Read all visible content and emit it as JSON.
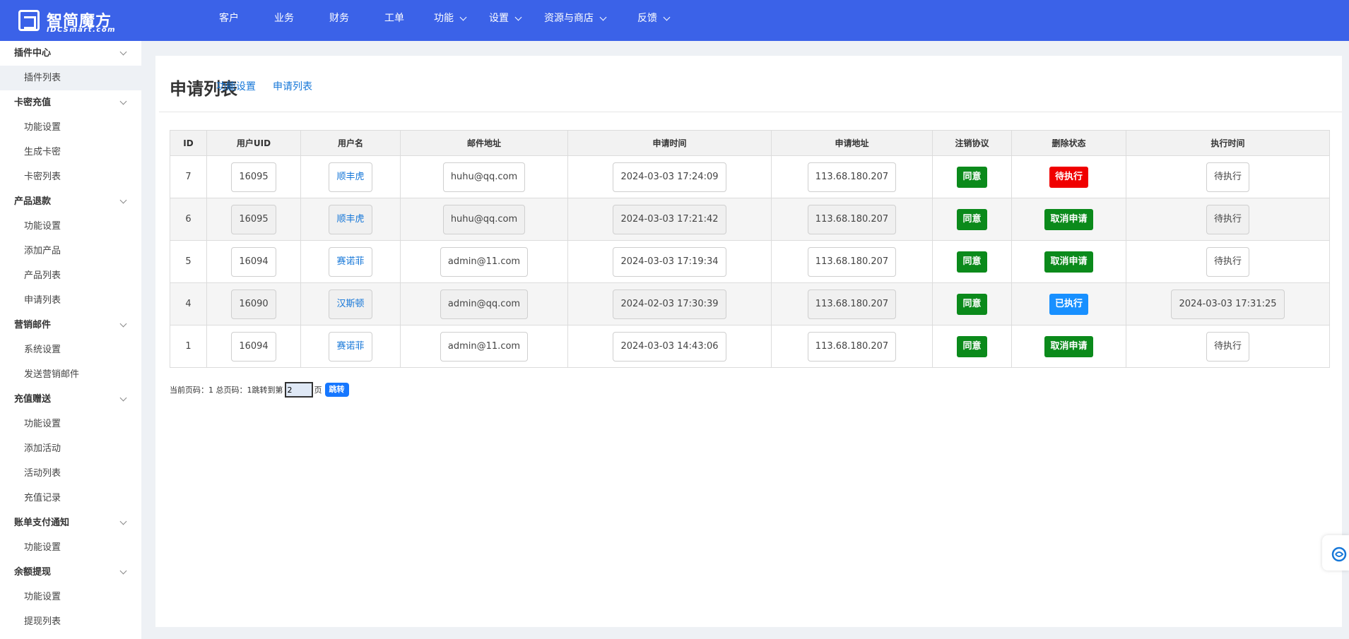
{
  "brand": {
    "name_cn": "智简魔方",
    "name_en": "IDCSmart.com"
  },
  "nav": {
    "items": [
      {
        "label": "客户",
        "has_dropdown": false
      },
      {
        "label": "业务",
        "has_dropdown": false
      },
      {
        "label": "财务",
        "has_dropdown": false
      },
      {
        "label": "工单",
        "has_dropdown": false
      },
      {
        "label": "功能",
        "has_dropdown": true
      },
      {
        "label": "设置",
        "has_dropdown": true
      },
      {
        "label": "资源与商店",
        "has_dropdown": true
      },
      {
        "label": "反馈",
        "has_dropdown": true
      }
    ]
  },
  "sidebar": {
    "groups": [
      {
        "label": "插件中心",
        "items": [
          "插件列表"
        ]
      },
      {
        "label": "卡密充值",
        "items": [
          "功能设置",
          "生成卡密",
          "卡密列表"
        ]
      },
      {
        "label": "产品退款",
        "items": [
          "功能设置",
          "添加产品",
          "产品列表",
          "申请列表"
        ]
      },
      {
        "label": "营销邮件",
        "items": [
          "系统设置",
          "发送营销邮件"
        ]
      },
      {
        "label": "充值赠送",
        "items": [
          "功能设置",
          "添加活动",
          "活动列表",
          "充值记录"
        ]
      },
      {
        "label": "账单支付通知",
        "items": [
          "功能设置"
        ]
      },
      {
        "label": "余额提现",
        "items": [
          "功能设置",
          "提现列表"
        ]
      }
    ],
    "active_item": "插件列表"
  },
  "page": {
    "title": "申请列表",
    "tabs": [
      "功能设置",
      "申请列表"
    ]
  },
  "table": {
    "headers": [
      "ID",
      "用户UID",
      "用户名",
      "邮件地址",
      "申请时间",
      "申请地址",
      "注销协议",
      "删除状态",
      "执行时间"
    ],
    "rows": [
      {
        "id": "7",
        "uid": "16095",
        "username": "顺丰虎",
        "email": "huhu@qq.com",
        "apply_time": "2024-03-03 17:24:09",
        "ip": "113.68.180.207",
        "agreement": "同意",
        "status": "待执行",
        "status_color": "#f00000",
        "exec_time": "待执行"
      },
      {
        "id": "6",
        "uid": "16095",
        "username": "顺丰虎",
        "email": "huhu@qq.com",
        "apply_time": "2024-03-03 17:21:42",
        "ip": "113.68.180.207",
        "agreement": "同意",
        "status": "取消申请",
        "status_color": "#0b8a1b",
        "exec_time": "待执行"
      },
      {
        "id": "5",
        "uid": "16094",
        "username": "赛诺菲",
        "email": "admin@11.com",
        "apply_time": "2024-03-03 17:19:34",
        "ip": "113.68.180.207",
        "agreement": "同意",
        "status": "取消申请",
        "status_color": "#0b8a1b",
        "exec_time": "待执行"
      },
      {
        "id": "4",
        "uid": "16090",
        "username": "汉斯顿",
        "email": "admin@qq.com",
        "apply_time": "2024-02-03 17:30:39",
        "ip": "113.68.180.207",
        "agreement": "同意",
        "status": "已执行",
        "status_color": "#1890ff",
        "exec_time": "2024-03-03 17:31:25"
      },
      {
        "id": "1",
        "uid": "16094",
        "username": "赛诺菲",
        "email": "admin@11.com",
        "apply_time": "2024-03-03 14:43:06",
        "ip": "113.68.180.207",
        "agreement": "同意",
        "status": "取消申请",
        "status_color": "#0b8a1b",
        "exec_time": "待执行"
      }
    ]
  },
  "pager": {
    "summary": "当前页码：1 总页码：1",
    "jump_label": "跳转到第",
    "jump_value": "2",
    "page_suffix": "页",
    "go_label": "跳转"
  },
  "colors": {
    "topbar": "#3b62e8",
    "link": "#1677d8",
    "green": "#0b8a1b",
    "red": "#f00000",
    "blue": "#1890ff"
  },
  "icons": {
    "float_help": "support-icon"
  }
}
